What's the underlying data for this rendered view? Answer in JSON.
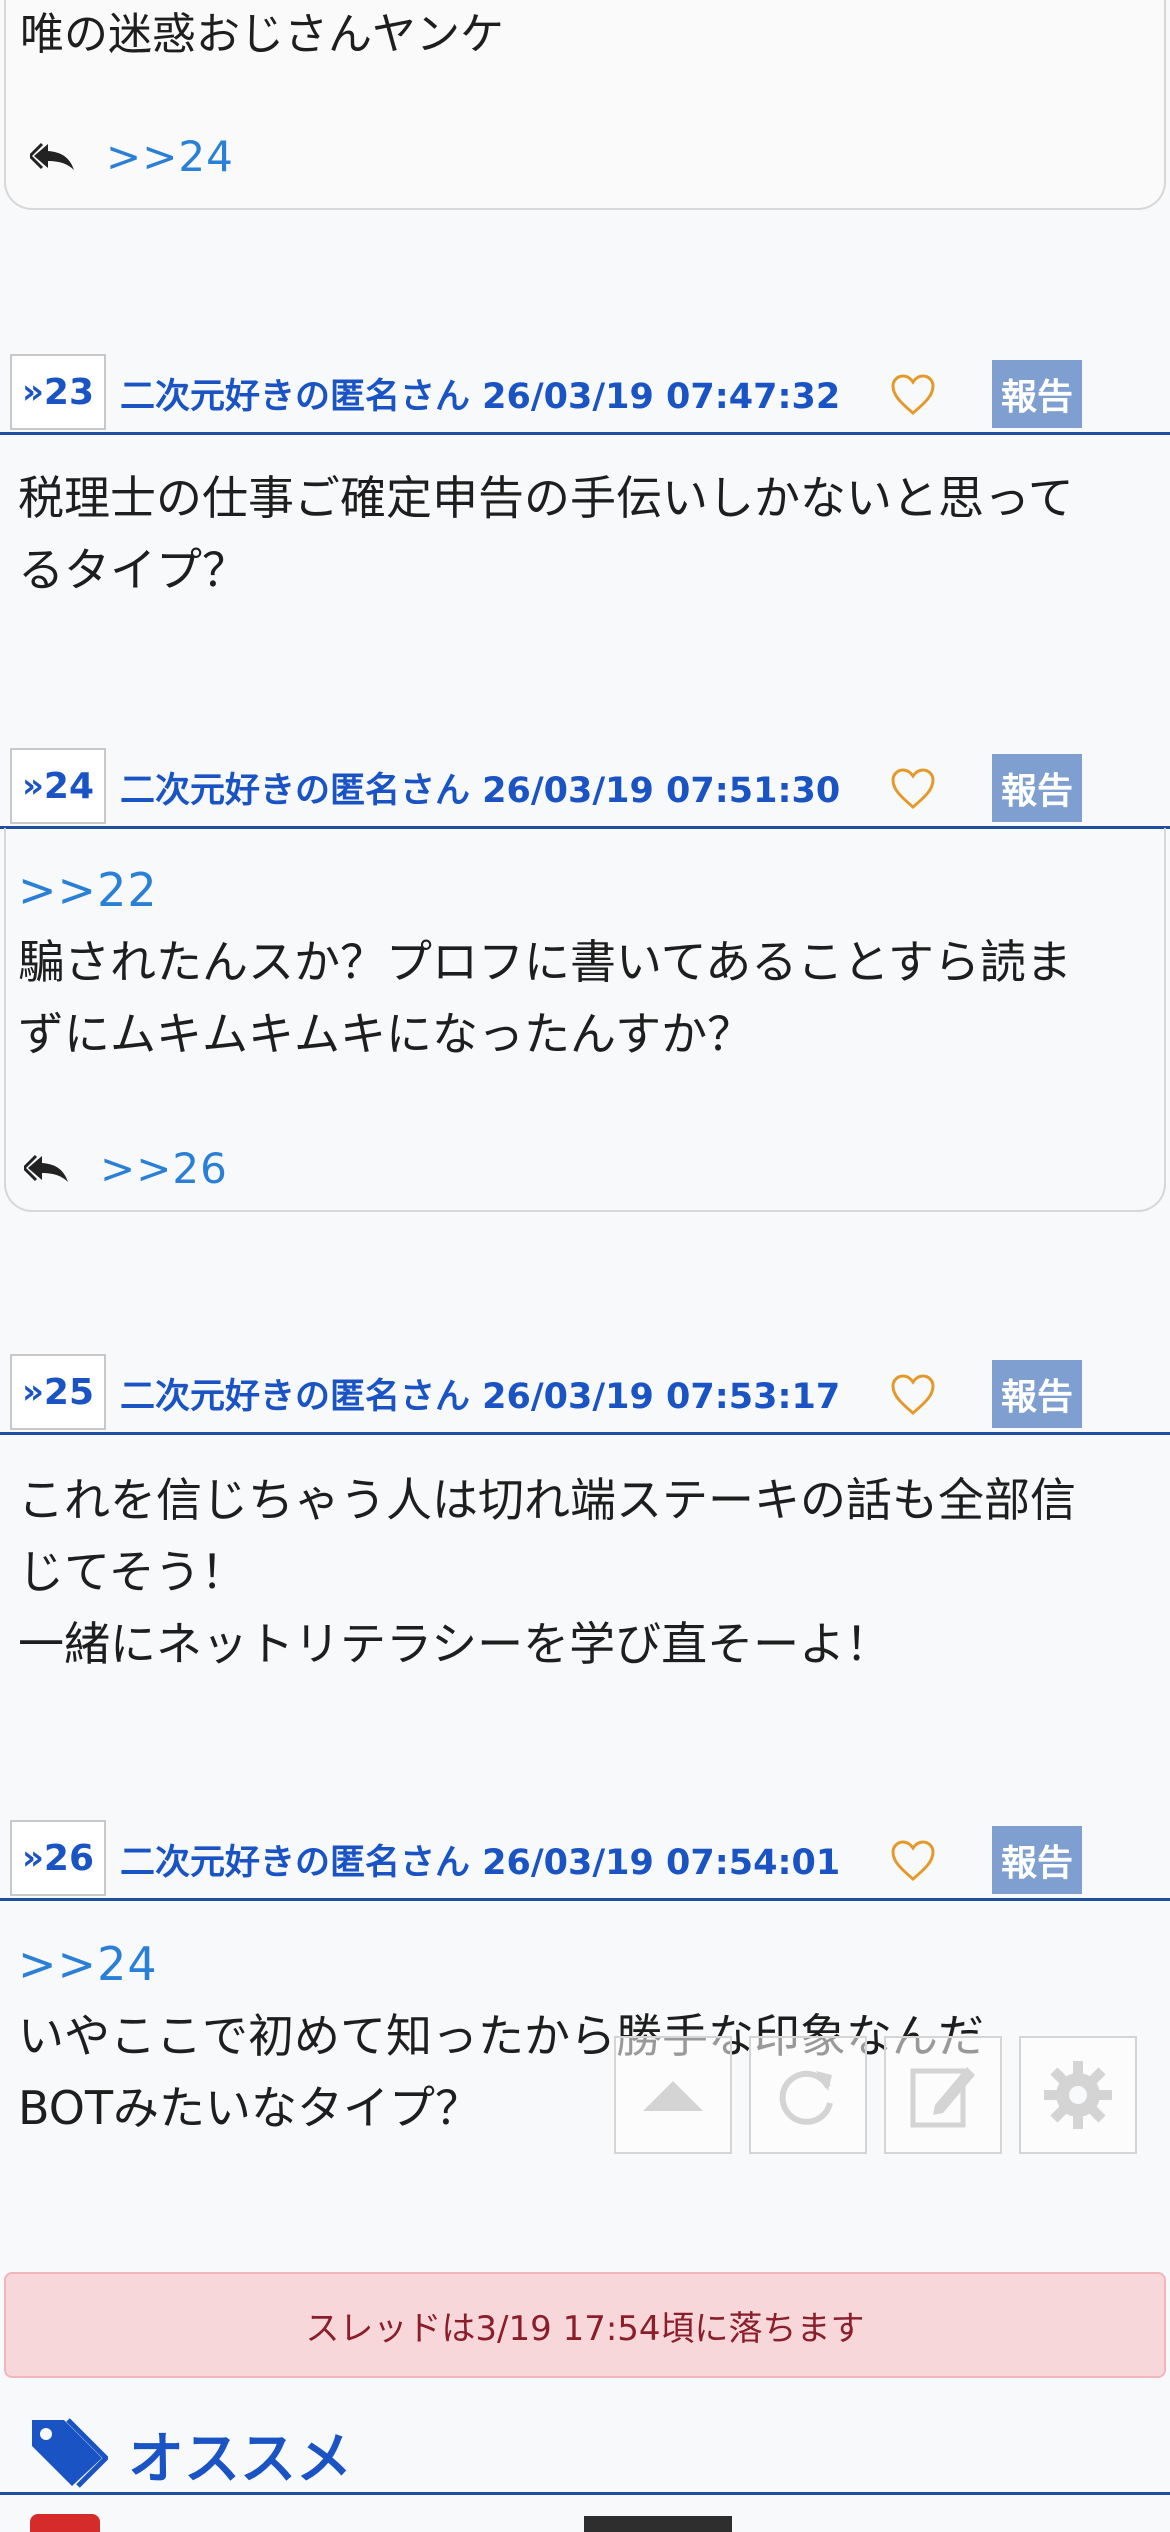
{
  "top_post": {
    "text": "唯の迷惑おじさんヤンケ",
    "reply_link": ">>24"
  },
  "posts": [
    {
      "num": "23",
      "meta": "二次元好きの匿名さん 26/03/19 07:47:32",
      "report": "報告",
      "lines": [
        "税理士の仕事ご確定申告の手伝いしかないと思って",
        "るタイプ？"
      ]
    },
    {
      "num": "24",
      "meta": "二次元好きの匿名さん 26/03/19 07:51:30",
      "report": "報告",
      "anchor": ">>22",
      "lines": [
        "騙されたんスか？プロフに書いてあることすら読ま",
        "ずにムキムキムキになったんすか？"
      ],
      "reply_link": ">>26"
    },
    {
      "num": "25",
      "meta": "二次元好きの匿名さん 26/03/19 07:53:17",
      "report": "報告",
      "lines": [
        "これを信じちゃう人は切れ端ステーキの話も全部信",
        "じてそう！",
        "一緒にネットリテラシーを学び直そーよ！"
      ]
    },
    {
      "num": "26",
      "meta": "二次元好きの匿名さん 26/03/19 07:54:01",
      "report": "報告",
      "anchor": ">>24",
      "lines": [
        "いやここで初めて知ったから勝手な印象なんだ",
        "BOTみたいなタイプ？"
      ]
    }
  ],
  "alert_text": "スレッドは3/19 17:54頃に落ちます",
  "recommend_title": "オススメ",
  "colors": {
    "accent": "#1a53c4",
    "link": "#2a7fd6",
    "report_bg": "#7f9fd1",
    "alert_bg": "#f8d7da",
    "alert_text": "#8a1e2b",
    "heart": "#e39a2a"
  },
  "floating_buttons": [
    "scroll-top-icon",
    "reload-icon",
    "edit-icon",
    "gear-icon"
  ]
}
